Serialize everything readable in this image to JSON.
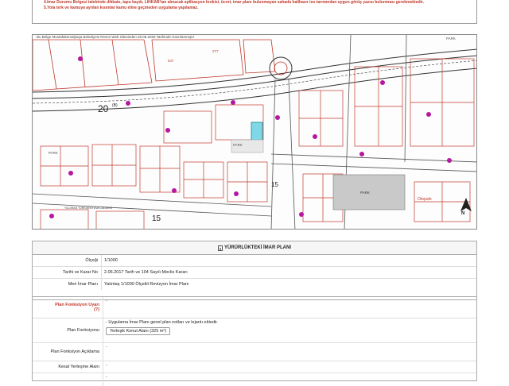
{
  "notes": {
    "line1": "4.İmar Durumu Belgesi talebinde dikkate, tapu kaydı, LİHKAB'tan alınacak aplikasyon krokisi, ücret, imar planı bulunmayan sahada halihazır iso tarımından uygun görüş yazısı bulunması gerekmektedir.",
    "line2": "5.Yola terk ve kamuya ayrılan kısımlar kamu eline geçmeden uygulama yapılamaz."
  },
  "map": {
    "caption": "Bu Belge Mustafakemalpaşa Belediyesi Resmi Web Sitesinden 26.06.2025 Tarihinde Hazırlanmıştır",
    "labels": {
      "l20": "20",
      "l20sup": "(B)",
      "l15": "15",
      "l15b": "15",
      "park": "PARK",
      "park2": "PARK",
      "park3": "PARK",
      "park4": "PARK",
      "otopark": "Otopark",
      "north": "N",
      "n547": "547",
      "n277": "277",
      "road": "YILDIRAN TÜRKMENYUVA CADDESİ"
    }
  },
  "plan": {
    "heading": "YÜRÜRLÜKTEKİ İMAR PLANI",
    "rows": [
      {
        "label": "Ölçeği",
        "value": "1/1000"
      },
      {
        "label": "Tarihi ve Karar No",
        "value": "2.06.2017 Tarih ve 104 Sayılı Meclis Kararı"
      },
      {
        "label": "Meri İmar Planı",
        "value": "Yalıntaş 1/1000 Ölçekli Revizyon İmar Planı"
      }
    ]
  },
  "functions": {
    "warning_label": "Plan Fonksiyon Uyarı",
    "warning_suffix": "(?)",
    "warning_value": "-",
    "function_label": "Plan Fonksiyonu",
    "function_text": "- Uygulama İmar Planı genel plan notları ve lejantı ektedir.",
    "function_chip": "Yerleşik Konut Alanı (325 m²)",
    "desc_label": "Plan Fonksiyon Açıklama",
    "desc_value": "-",
    "kesal_label": "Kesal Yerleşme Alanı",
    "kesal_value": "-",
    "extra_value": "-"
  }
}
